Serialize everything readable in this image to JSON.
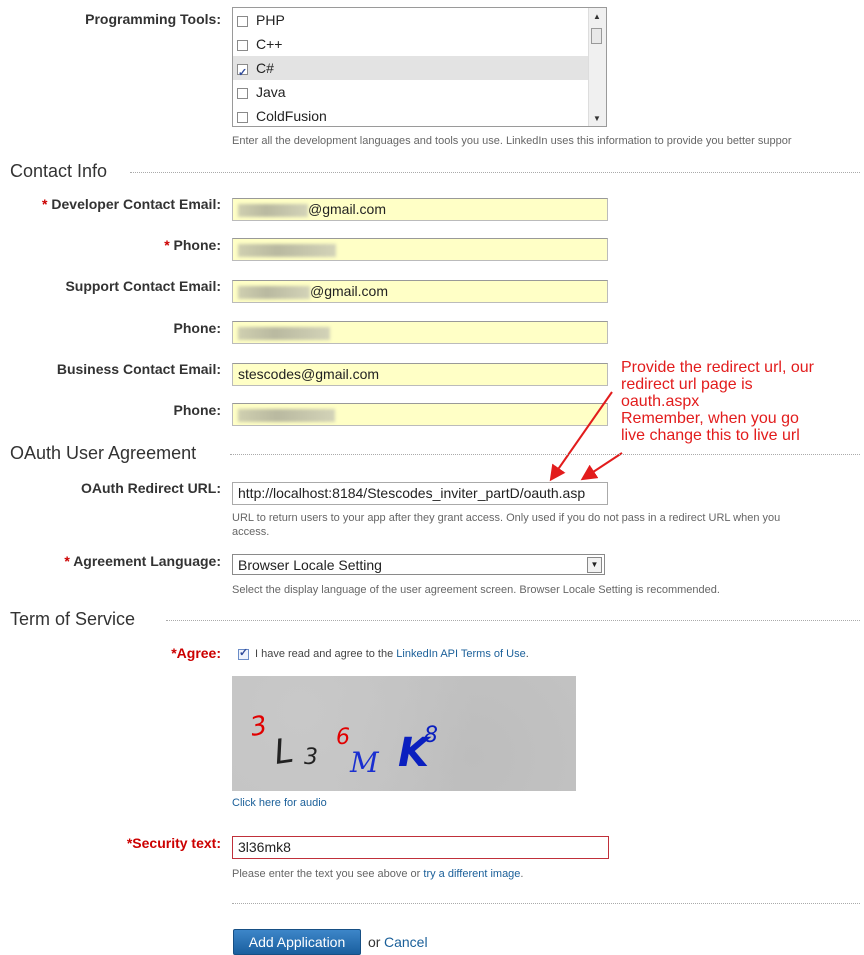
{
  "programming_tools": {
    "label": "Programming Tools:",
    "options": [
      {
        "label": "PHP",
        "checked": false
      },
      {
        "label": "C++",
        "checked": false
      },
      {
        "label": "C#",
        "checked": true
      },
      {
        "label": "Java",
        "checked": false
      },
      {
        "label": "ColdFusion",
        "checked": false
      }
    ],
    "help": "Enter all the development languages and tools you use. LinkedIn uses this information to provide you better suppor"
  },
  "contact_info": {
    "title": "Contact Info",
    "dev_email_label": "Developer Contact Email:",
    "dev_email_value": "@gmail.com",
    "dev_phone_label": "Phone:",
    "support_email_label": "Support Contact Email:",
    "support_email_value": "@gmail.com",
    "support_phone_label": "Phone:",
    "business_email_label": "Business Contact Email:",
    "business_email_value": "stescodes@gmail.com",
    "business_phone_label": "Phone:"
  },
  "oauth": {
    "title": "OAuth User Agreement",
    "redirect_label": "OAuth Redirect URL:",
    "redirect_value": "http://localhost:8184/Stescodes_inviter_partD/oauth.asp",
    "redirect_help_1": "URL to return users to your app after they grant access. Only used if you do not pass in a redirect URL when you",
    "redirect_help_2": "access.",
    "language_label": "Agreement Language:",
    "language_value": "Browser Locale Setting",
    "language_help": "Select the display language of the user agreement screen. Browser Locale Setting is recommended."
  },
  "annotation": {
    "line1": "Provide the redirect url, our",
    "line2": "redirect url page is",
    "line3": "oauth.aspx",
    "line4": "Remember, when you go",
    "line5": "live change this to live url",
    "color": "#e21c1c"
  },
  "terms": {
    "title": "Term of Service",
    "agree_label": "*Agree:",
    "agree_text": "I have read and agree to the ",
    "agree_link": "LinkedIn API Terms of Use",
    "agree_end": ".",
    "captcha_text": "3L36MK8",
    "audio_link": "Click here for audio",
    "security_label": "*Security text:",
    "security_value": "3l36mk8",
    "security_help": "Please enter the text you see above or ",
    "security_help_link": "try a different image",
    "security_help_end": "."
  },
  "actions": {
    "submit_label": "Add Application",
    "or_text": "or",
    "cancel_label": "Cancel"
  },
  "colors": {
    "accent": "#1a5f99",
    "field_bg": "#ffffc6",
    "required": "#cc0000"
  }
}
